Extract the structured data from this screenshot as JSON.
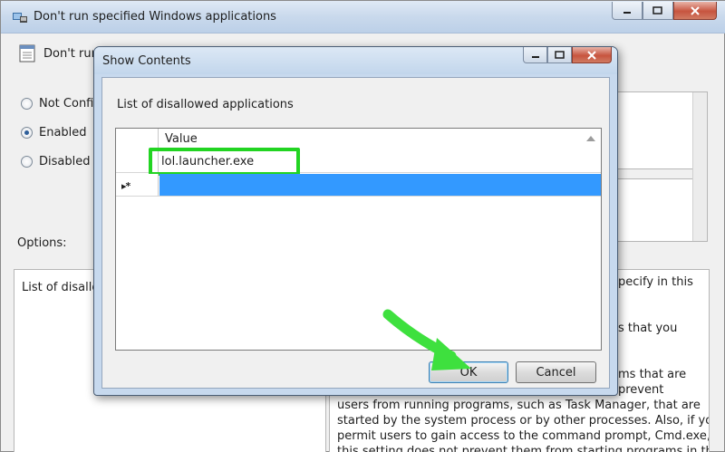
{
  "main_window": {
    "title": "Don't run specified Windows applications",
    "policy_title": "Don't run",
    "radios": [
      {
        "label": "Not Confi",
        "checked": false
      },
      {
        "label": "Enabled",
        "checked": true
      },
      {
        "label": "Disabled",
        "checked": false
      }
    ],
    "options_label": "Options:",
    "options_text": "List of disallo",
    "help_lines": [
      "pecify in this",
      "s that you",
      "ms that are",
      "prevent",
      "users from running programs, such as Task Manager, that are",
      "started by the system process or by other processes.  Also, if you",
      "permit users to gain access to the command prompt, Cmd.exe,",
      "this setting does not prevent them from starting programs in the"
    ]
  },
  "dialog": {
    "title": "Show Contents",
    "caption": "List of disallowed applications",
    "column_header": "Value",
    "rows": [
      {
        "value": "lol.launcher.exe"
      }
    ],
    "new_row_marker": "▸*",
    "ok_label": "OK",
    "cancel_label": "Cancel"
  },
  "colors": {
    "highlight": "#22d422",
    "selection": "#3399ff",
    "arrow": "#3ee03e"
  }
}
